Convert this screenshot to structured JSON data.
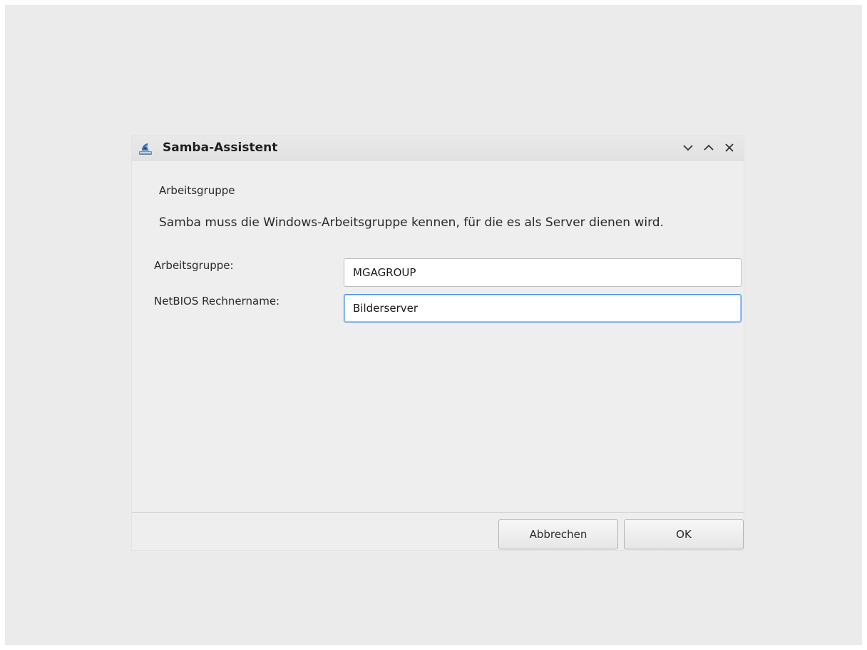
{
  "window": {
    "title": "Samba-Assistent",
    "icon": "samba-icon",
    "controls": [
      "minimize-icon",
      "maximize-icon",
      "close-icon"
    ]
  },
  "content": {
    "heading": "Arbeitsgruppe",
    "description": "Samba muss die Windows-Arbeitsgruppe kennen, für die es als Server dienen wird."
  },
  "form": {
    "workgroup_label": "Arbeitsgruppe:",
    "workgroup_value": "MGAGROUP",
    "netbios_label": "NetBIOS Rechnername:",
    "netbios_value": "Bilderserver"
  },
  "buttons": {
    "cancel": "Abbrechen",
    "ok": "OK"
  },
  "colors": {
    "focus_border": "#3d8ee6",
    "background": "#ebebeb"
  }
}
